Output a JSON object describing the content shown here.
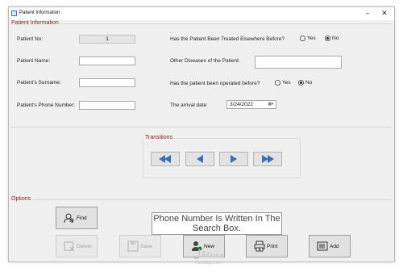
{
  "window": {
    "title": "Patient Information",
    "minimize_label": "–",
    "close_label": "✕"
  },
  "patient_section": {
    "label": "Patient Information",
    "patient_no_label": "Patient No:",
    "patient_no_value": "1",
    "name_label": "Patient Name:",
    "name_value": "",
    "surname_label": "Patient's Surname:",
    "surname_value": "",
    "phone_label": "Patient's Phone Number:",
    "phone_value": "",
    "treated_elsewhere_label": "Has the Patient Been Treated Elsewhere Before?",
    "treated_yes": "Yes",
    "treated_no": "No",
    "treated_selected": "No",
    "other_diseases_label": "Other Diseases of the Patient:",
    "other_diseases_value": "",
    "operated_label": "Has the patient been operated before?",
    "operated_yes": "Yes",
    "operated_no": "No",
    "operated_selected": "No",
    "arrival_label": "The arrival date:",
    "arrival_value": "3/24/2022",
    "date_dropdown_label": "▦▾"
  },
  "transitions": {
    "label": "Transitions",
    "buttons": [
      {
        "name": "first-record",
        "icon": "double-left-arrow"
      },
      {
        "name": "previous-record",
        "icon": "left-arrow"
      },
      {
        "name": "next-record",
        "icon": "right-arrow"
      },
      {
        "name": "last-record",
        "icon": "double-right-arrow"
      }
    ]
  },
  "options": {
    "label": "Options",
    "find_label": "Find",
    "message": "Phone Number Is Written In The Search Box.",
    "delete_label": "Delete",
    "save_label": "Save",
    "new_label": "New",
    "print_label": "Print",
    "add_label": "Add"
  },
  "colors": {
    "accent": "#8b1a1a",
    "nav_arrow": "#3b6fb6"
  },
  "watermark": {
    "text": "مستقل",
    "sub": "mostaql.com"
  }
}
